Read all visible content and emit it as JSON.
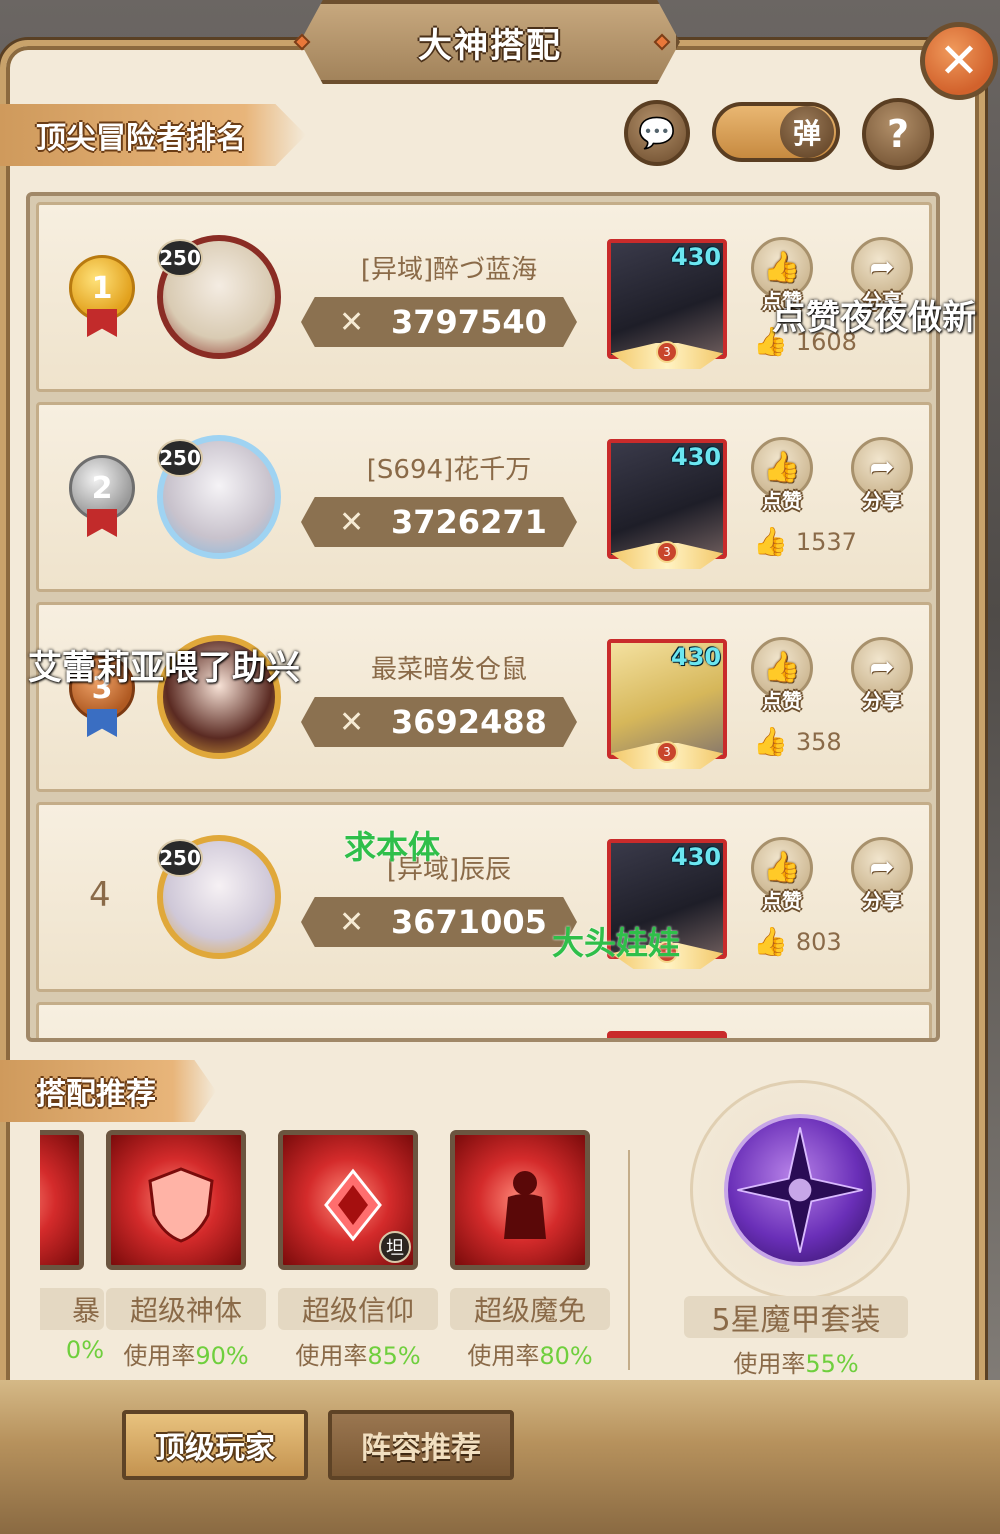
{
  "window": {
    "title": "大神搭配"
  },
  "controls": {
    "toggle_label": "弹",
    "help_icon": "?"
  },
  "ranking": {
    "section_title": "顶尖冒险者排名",
    "players": [
      {
        "rank": "1",
        "level": "250",
        "name": "[异域]醉づ蓝海",
        "power": "3797540",
        "hero_level": "430",
        "hero_star": "3",
        "like_label": "点赞",
        "share_label": "分享",
        "likes": "1608"
      },
      {
        "rank": "2",
        "level": "250",
        "name": "[S694]花千万",
        "power": "3726271",
        "hero_level": "430",
        "hero_star": "3",
        "like_label": "点赞",
        "share_label": "分享",
        "likes": "1537"
      },
      {
        "rank": "3",
        "level": "250",
        "name": "最菜暗发仓鼠",
        "power": "3692488",
        "hero_level": "430",
        "hero_star": "3",
        "like_label": "点赞",
        "share_label": "分享",
        "likes": "358"
      },
      {
        "rank": "4",
        "level": "250",
        "name": "[异域]辰辰",
        "power": "3671005",
        "hero_level": "430",
        "hero_star": "3",
        "like_label": "点赞",
        "share_label": "分享",
        "likes": "803"
      }
    ]
  },
  "danmaku": [
    {
      "text": "点赞夜夜做新",
      "color": "#ffffff"
    },
    {
      "text": "艾蕾莉亚喂了助兴",
      "color": "#ffffff"
    },
    {
      "text": "求本体",
      "color": "#2fbf4a"
    },
    {
      "text": "大头娃娃",
      "color": "#2fbf4a"
    }
  ],
  "recommend": {
    "section_title": "搭配推荐",
    "items": [
      {
        "name": "暴",
        "rate_label": "使用率",
        "rate": "0%"
      },
      {
        "name": "超级神体",
        "rate_label": "使用率",
        "rate": "90%"
      },
      {
        "name": "超级信仰",
        "rate_label": "使用率",
        "rate": "85%",
        "badge": "坦"
      },
      {
        "name": "超级魔免",
        "rate_label": "使用率",
        "rate": "80%"
      }
    ],
    "armor": {
      "name": "5星魔甲套装",
      "rate_label": "使用率",
      "rate": "55%"
    }
  },
  "tabs": {
    "top_players": "顶级玩家",
    "lineup": "阵容推荐"
  },
  "colors": {
    "accent": "#c9a36b",
    "rate_green": "#6fcf3d",
    "close_orange": "#d2622c"
  }
}
